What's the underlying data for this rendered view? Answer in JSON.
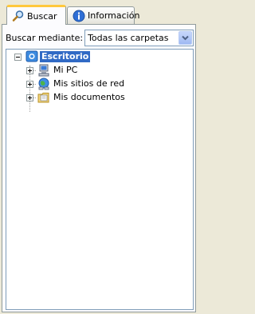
{
  "tabs": [
    {
      "label": "Buscar",
      "icon": "magnifier-icon",
      "active": true
    },
    {
      "label": "Información",
      "icon": "info-icon",
      "active": false
    }
  ],
  "search": {
    "label": "Buscar mediante:",
    "selected": "Todas las carpetas"
  },
  "tree": {
    "root": {
      "label": "Escritorio",
      "icon": "desktop-icon",
      "expanded": true,
      "selected": true
    },
    "children": [
      {
        "label": "Mi PC",
        "icon": "computer-icon"
      },
      {
        "label": "Mis sitios de red",
        "icon": "network-icon"
      },
      {
        "label": "Mis documentos",
        "icon": "documents-folder-icon"
      }
    ]
  },
  "colors": {
    "selection": "#316ac5",
    "background": "#ece9d8",
    "tab_highlight": "#ffc83c"
  }
}
